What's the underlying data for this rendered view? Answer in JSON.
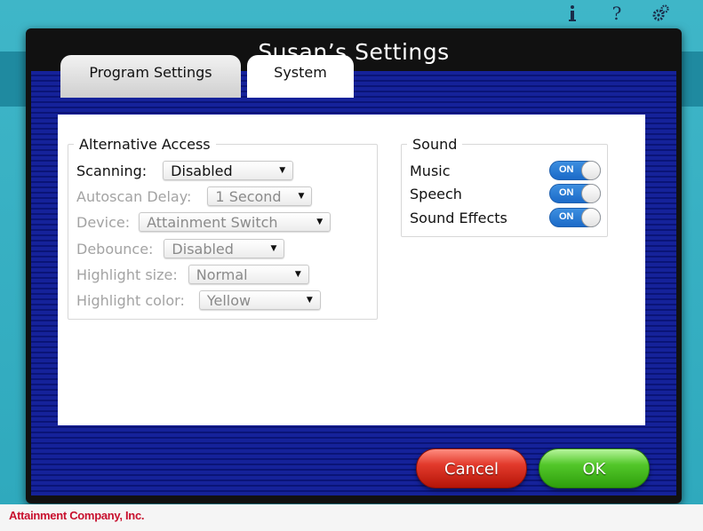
{
  "company": "Attainment Company, Inc.",
  "top_icons": [
    "info-icon",
    "help-icon",
    "settings-gears-icon"
  ],
  "dialog": {
    "title": "Susan’s Settings",
    "tabs": [
      {
        "label": "Program Settings",
        "active": false
      },
      {
        "label": "System",
        "active": true
      }
    ]
  },
  "alternative_access": {
    "title": "Alternative Access",
    "rows": [
      {
        "label": "Scanning:",
        "value": "Disabled",
        "enabled": true
      },
      {
        "label": "Autoscan Delay:",
        "value": "1 Second",
        "enabled": false
      },
      {
        "label": "Device:",
        "value": "Attainment Switch",
        "enabled": false
      },
      {
        "label": "Debounce:",
        "value": "Disabled",
        "enabled": false
      },
      {
        "label": "Highlight size:",
        "value": "Normal",
        "enabled": false
      },
      {
        "label": "Highlight color:",
        "value": "Yellow",
        "enabled": false
      }
    ]
  },
  "sound": {
    "title": "Sound",
    "rows": [
      {
        "label": "Music",
        "state": "ON"
      },
      {
        "label": "Speech",
        "state": "ON"
      },
      {
        "label": "Sound Effects",
        "state": "ON"
      }
    ]
  },
  "buttons": {
    "cancel": "Cancel",
    "ok": "OK"
  },
  "colors": {
    "app_background": "#3fb6c8",
    "dialog_body": "#0d1a8a",
    "toggle_on": "#1b6ac8",
    "cancel": "#e23a2c",
    "ok": "#53c72a",
    "brand": "#c8102e"
  }
}
